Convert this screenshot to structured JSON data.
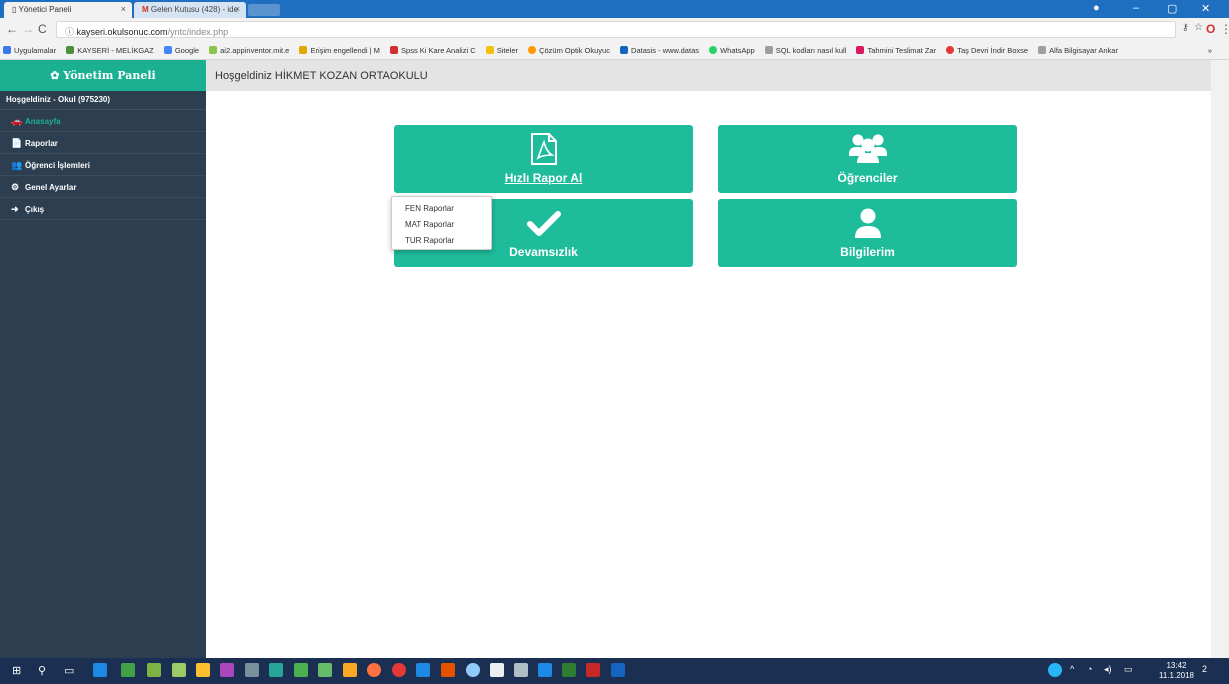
{
  "browser": {
    "tabs": [
      {
        "title": "Yönetici Paneli",
        "close": "×"
      },
      {
        "title": "Gelen Kutusu (428) - ide",
        "close": "×"
      }
    ],
    "window_controls": {
      "minimize": "–",
      "maximize": "▢",
      "close": "✕"
    },
    "url_host": "kayseri.okulsonuc.com",
    "url_path": "/yntc/index.php",
    "bookmarks": [
      {
        "label": "Uygulamalar",
        "color": "#3b78e7"
      },
      {
        "label": "KAYSERİ - MELİKGAZ",
        "color": "#4a8f3c"
      },
      {
        "label": "Google",
        "color": "#4285f4"
      },
      {
        "label": "ai2.appinventor.mit.e",
        "color": "#8bc34a"
      },
      {
        "label": "Erişim engellendi | M",
        "color": "#e0a800"
      },
      {
        "label": "Spss Ki Kare Analizi C",
        "color": "#d32f2f"
      },
      {
        "label": "Siteler",
        "color": "#f4c20d"
      },
      {
        "label": "Çözüm Optik Okuyuc",
        "color": "#ff9800"
      },
      {
        "label": "Datasis - www.datas",
        "color": "#1565c0"
      },
      {
        "label": "WhatsApp",
        "color": "#25d366"
      },
      {
        "label": "SQL kodları nasıl kull",
        "color": "#9e9e9e"
      },
      {
        "label": "Tahmini Teslimat Zar",
        "color": "#d81b60"
      },
      {
        "label": "Taş Devri İndir Boxse",
        "color": "#e53935"
      },
      {
        "label": "Alfa Bilgisayar Ankar",
        "color": "#9e9e9e"
      }
    ],
    "bookmarks_more": "»"
  },
  "sidebar": {
    "title": "✿ Yönetim Paneli",
    "welcome": "Hoşgeldiniz - Okul (975230)",
    "items": [
      {
        "label": "Anasayfa",
        "icon": "🚗",
        "active": true
      },
      {
        "label": "Raporlar",
        "icon": "📄",
        "active": false
      },
      {
        "label": "Öğrenci İşlemleri",
        "icon": "👥",
        "active": false
      },
      {
        "label": "Genel Ayarlar",
        "icon": "⚙",
        "active": false
      },
      {
        "label": "Çıkış",
        "icon": "➜",
        "active": false
      }
    ]
  },
  "header": {
    "greeting": "Hoşgeldiniz HİKMET KOZAN ORTAOKULU"
  },
  "cards": {
    "quick_report": "Hızlı Rapor Al",
    "students": "Öğrenciler",
    "attendance": "Devamsızlık",
    "my_info": "Bilgilerim"
  },
  "dropdown": {
    "items": [
      "FEN Raporlar",
      "MAT Raporlar",
      "TUR Raporlar"
    ]
  },
  "taskbar": {
    "time": "13:42",
    "date": "11.1.2018",
    "notifications": "2"
  }
}
